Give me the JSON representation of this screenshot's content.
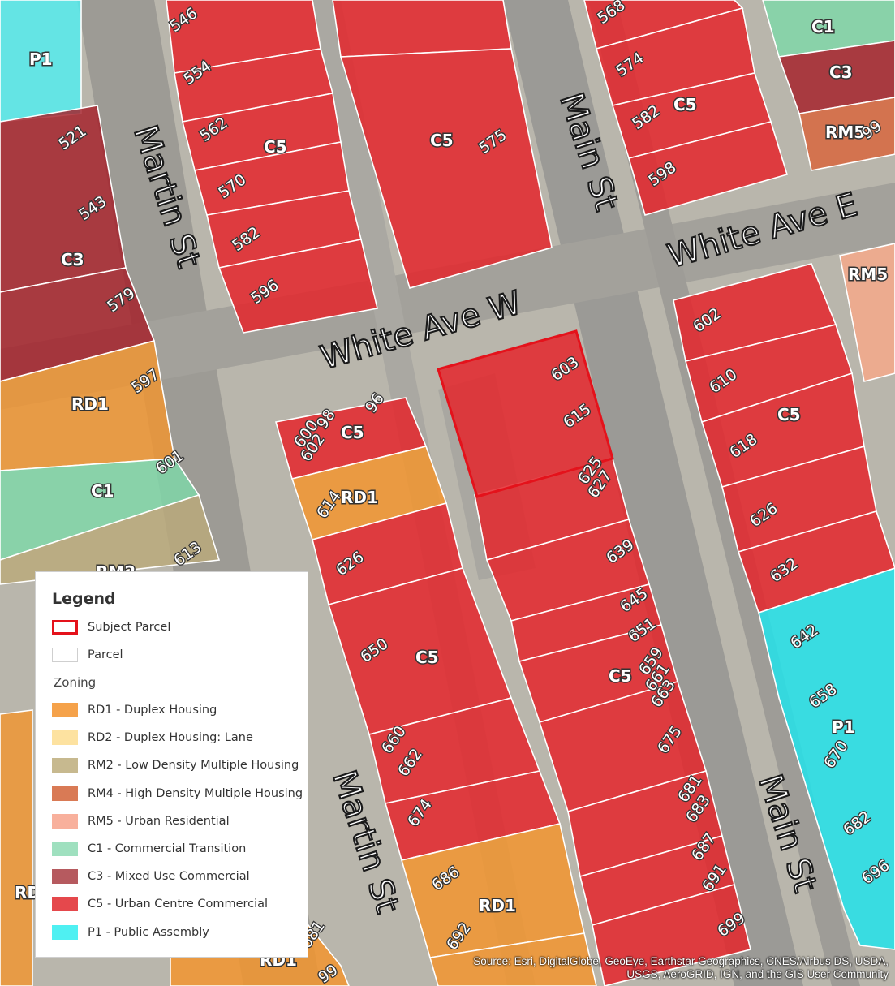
{
  "streets": {
    "martin_north": "Martin St",
    "martin_south": "Martin St",
    "main_north": "Main St",
    "main_south": "Main St",
    "white_w": "White Ave W",
    "white_e": "White Ave E"
  },
  "zone_labels": {
    "p1_top": "P1",
    "c3_left": "C3",
    "rd1_left": "RD1",
    "c1_left": "C1",
    "rm2_left": "RM2",
    "rd_left": "RD",
    "c5_a": "C5",
    "c5_b": "C5",
    "c5_c": "C5",
    "c5_d": "C5",
    "rd1_mid": "RD1",
    "c5_e": "C5",
    "c5_f": "C5",
    "rd1_bottom": "RD1",
    "rd1_bl": "RD1",
    "c1_tr": "C1",
    "c3_tr": "C3",
    "rm5_tr": "RM5",
    "rm5_r": "RM5",
    "c5_r": "C5",
    "p1_r": "P1"
  },
  "addresses": {
    "a546": "546",
    "a554": "554",
    "a562": "562",
    "a570": "570",
    "a582": "582",
    "a596": "596",
    "a521": "521",
    "a543": "543",
    "a579": "579",
    "a597": "597",
    "a601": "601",
    "a613": "613",
    "a575": "575",
    "a568": "568",
    "a574": "574",
    "a582e": "582",
    "a598": "598",
    "a99": "99",
    "a603": "603",
    "a615": "615",
    "a625": "625",
    "a627": "627",
    "a639": "639",
    "a645": "645",
    "a651": "651",
    "a659": "659",
    "a661": "661",
    "a663": "663",
    "a675": "675",
    "a681": "681",
    "a683": "683",
    "a687": "687",
    "a691": "691",
    "a699": "699",
    "a600": "600",
    "a602": "602",
    "a96": "96",
    "a98": "98",
    "a614": "614",
    "a626": "626",
    "a650": "650",
    "a660": "660",
    "a662": "662",
    "a674": "674",
    "a686": "686",
    "a692": "692",
    "a681b": "681",
    "a699b": "99",
    "a602e": "602",
    "a610": "610",
    "a618": "618",
    "a626e": "626",
    "a632": "632",
    "a642": "642",
    "a658": "658",
    "a670": "670",
    "a682": "682",
    "a696": "696"
  },
  "legend": {
    "title": "Legend",
    "subject_parcel": "Subject Parcel",
    "parcel": "Parcel",
    "zoning_heading": "Zoning",
    "items": [
      {
        "label": "RD1 - Duplex Housing",
        "color": "#f5a24a"
      },
      {
        "label": "RD2 - Duplex Housing: Lane",
        "color": "#fde2a0"
      },
      {
        "label": "RM2 - Low Density Multiple Housing",
        "color": "#c7b98f"
      },
      {
        "label": "RM4 - High Density Multiple Housing",
        "color": "#d97a55"
      },
      {
        "label": "RM5 - Urban Residential",
        "color": "#f8b09c"
      },
      {
        "label": "C1 - Commercial Transition",
        "color": "#9fe0bf"
      },
      {
        "label": "C3 - Mixed Use Commercial",
        "color": "#b65a5f"
      },
      {
        "label": "C5 - Urban Centre Commercial",
        "color": "#e5484c"
      },
      {
        "label": "P1 - Public Assembly",
        "color": "#4ff0f2"
      }
    ],
    "subject_color": "#e4121b"
  },
  "attribution": "Source: Esri, DigitalGlobe, GeoEye, Earthstar Geographics, CNES/Airbus DS, USDA, USGS, AeroGRID, IGN, and the GIS User Community"
}
